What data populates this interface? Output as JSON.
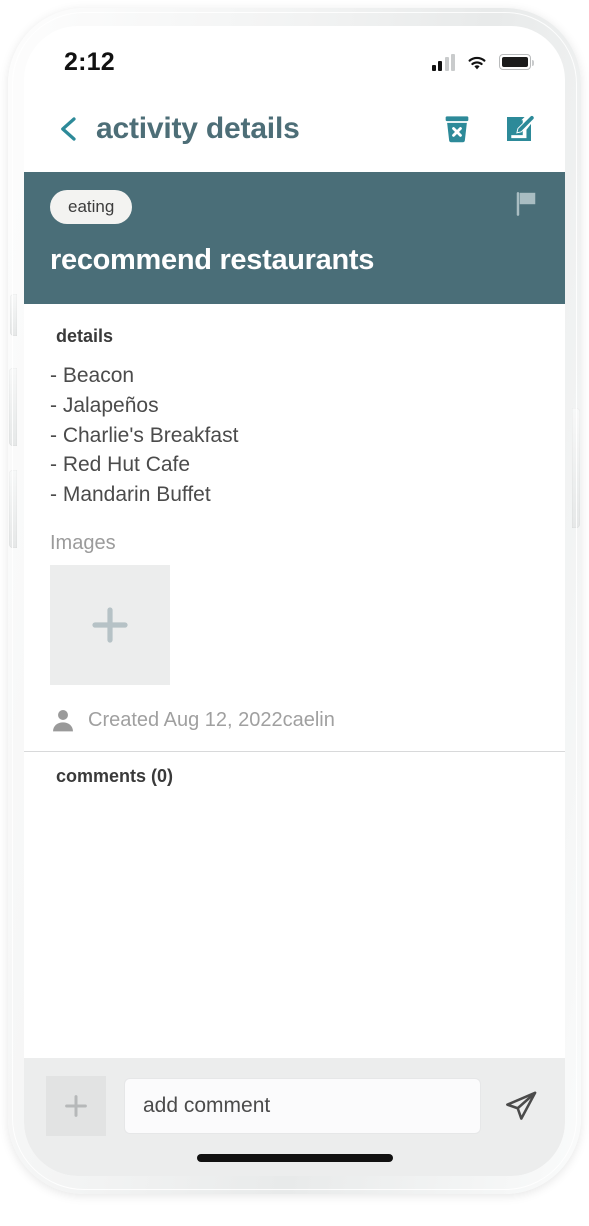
{
  "status_bar": {
    "time": "2:12",
    "signal_icon": "cellular-signal-icon",
    "wifi_icon": "wifi-icon",
    "battery_icon": "battery-icon"
  },
  "navbar": {
    "back_icon": "chevron-left-icon",
    "title": "activity details",
    "delete_icon": "trash-x-icon",
    "edit_icon": "edit-pencil-square-icon",
    "accent_color": "#2d8a99",
    "title_color": "#4d6e77"
  },
  "banner": {
    "category_pill": "eating",
    "flag_icon": "flag-icon",
    "title": "recommend restaurants",
    "background_color": "#4a6e78",
    "pill_background": "#f3f3f1",
    "flag_color": "#a9bdc2"
  },
  "detail": {
    "label": "details",
    "body": "- Beacon\n- Jalapeños\n- Charlie's Breakfast\n- Red Hut Cafe\n- Mandarin Buffet",
    "images_label": "Images",
    "add_image_icon": "plus-icon",
    "created_avatar_icon": "person-icon",
    "created_text": "Created Aug 12, 2022caelin"
  },
  "comments": {
    "label": "comments (0)",
    "items": []
  },
  "compose": {
    "attach_icon": "plus-icon",
    "input_value": "",
    "input_placeholder": "add comment",
    "send_icon": "paper-plane-send-icon"
  }
}
